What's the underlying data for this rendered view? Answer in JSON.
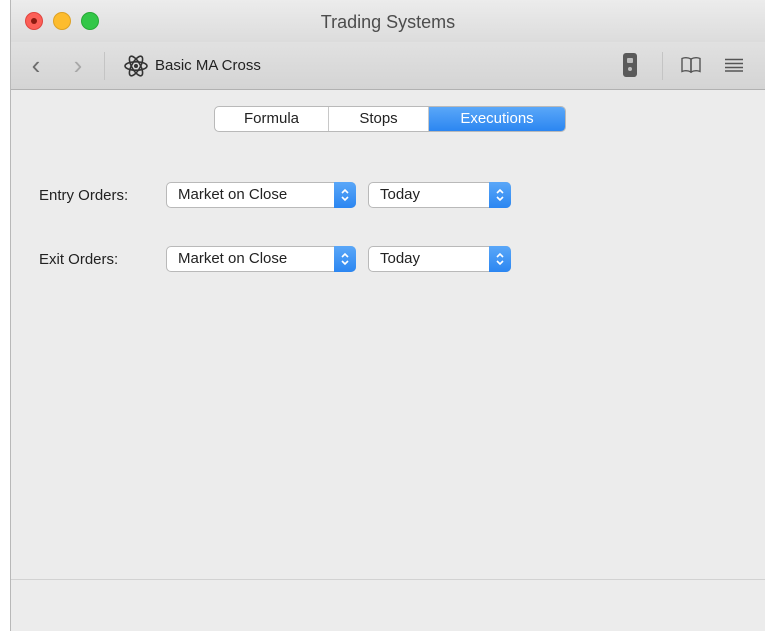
{
  "window": {
    "title": "Trading Systems"
  },
  "toolbar": {
    "back_icon": "chevron-left-icon",
    "forward_icon": "chevron-right-icon",
    "doc_icon": "atom-icon",
    "doc_title": "Basic MA Cross",
    "right_icons": [
      "phone-icon",
      "book-icon",
      "list-icon"
    ]
  },
  "tabs": [
    {
      "label": "Formula",
      "selected": false
    },
    {
      "label": "Stops",
      "selected": false
    },
    {
      "label": "Executions",
      "selected": true
    }
  ],
  "orders": {
    "entry": {
      "label": "Entry Orders:",
      "type": "Market on Close",
      "time": "Today"
    },
    "exit": {
      "label": "Exit Orders:",
      "type": "Market on Close",
      "time": "Today"
    }
  },
  "colors": {
    "accent": "#2b86f1",
    "close": "#fc5f57",
    "minimize": "#fdbc2e",
    "maximize": "#33c748"
  }
}
